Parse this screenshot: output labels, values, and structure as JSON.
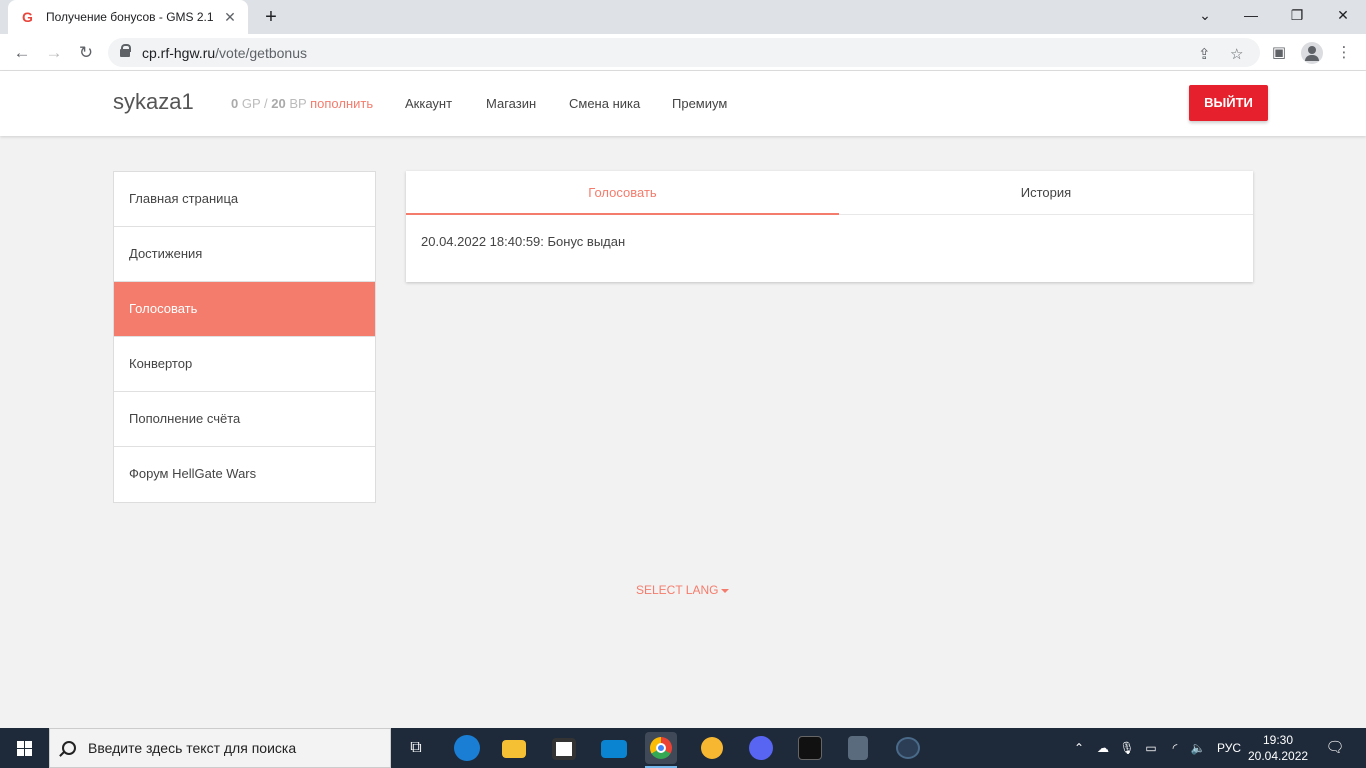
{
  "browser": {
    "tab_title": "Получение бонусов - GMS 2.1",
    "favicon": "G",
    "url_host": "cp.rf-hgw.ru",
    "url_path": "/vote/getbonus"
  },
  "header": {
    "username": "sykaza1",
    "gp_value": "0",
    "gp_unit": "GP",
    "separator": "/",
    "bp_value": "20",
    "bp_unit": "BP",
    "topup_label": "пополнить",
    "nav": [
      "Аккаунт",
      "Магазин",
      "Смена ника",
      "Премиум"
    ],
    "logout_label": "ВЫЙТИ"
  },
  "sidebar": {
    "items": [
      {
        "label": "Главная страница"
      },
      {
        "label": "Достижения"
      },
      {
        "label": "Голосовать"
      },
      {
        "label": "Конвертор"
      },
      {
        "label": "Пополнение счёта"
      },
      {
        "label": "Форум HellGate Wars"
      }
    ],
    "active_index": 2
  },
  "main": {
    "tabs": [
      "Голосовать",
      "История"
    ],
    "active_tab": 0,
    "message": "20.04.2022 18:40:59: Бонус выдан"
  },
  "footer": {
    "lang_label": "SELECT LANG"
  },
  "taskbar": {
    "search_placeholder": "Введите здесь текст для поиска",
    "lang": "РУС",
    "time": "19:30",
    "date": "20.04.2022"
  },
  "colors": {
    "accent": "#f47c6c",
    "logout": "#e6202c",
    "taskbar": "#1e2a3a"
  }
}
